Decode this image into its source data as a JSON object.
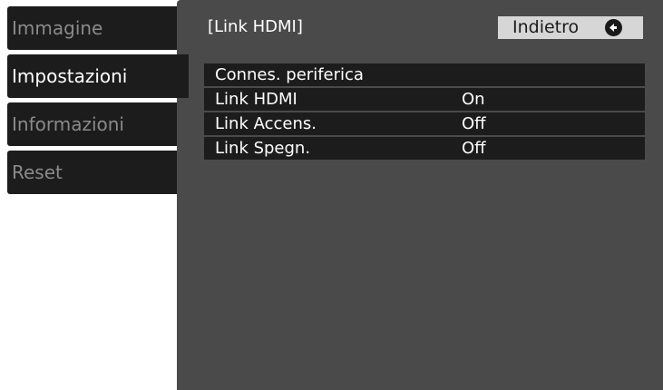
{
  "sidebar": {
    "items": [
      {
        "label": "Immagine"
      },
      {
        "label": "Impostazioni"
      },
      {
        "label": "Informazioni"
      },
      {
        "label": "Reset"
      }
    ]
  },
  "panel": {
    "title": "[Link HDMI]",
    "back_label": "Indietro",
    "back_icon": "return-icon"
  },
  "menu": {
    "rows": [
      {
        "label": "Connes. periferica",
        "value": ""
      },
      {
        "label": "Link HDMI",
        "value": "On"
      },
      {
        "label": "Link Accens.",
        "value": "Off"
      },
      {
        "label": "Link Spegn.",
        "value": "Off"
      }
    ]
  },
  "colors": {
    "panel_bg": "#4a4a4a",
    "item_bg": "#1c1c1c",
    "text_active": "#ffffff",
    "text_inactive": "#8a8a8a",
    "back_button_bg": "#d6d6d6"
  }
}
